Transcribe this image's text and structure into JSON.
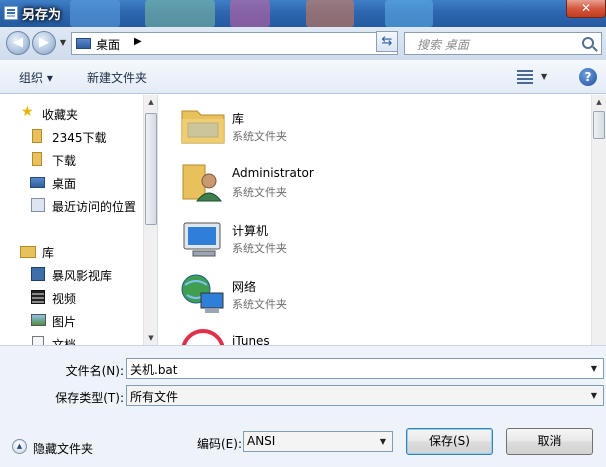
{
  "window": {
    "title": "另存为",
    "close_label": "✕"
  },
  "address": {
    "back_glyph": "◀",
    "forward_glyph": "▶",
    "location": "桌面",
    "separator": "▶",
    "search_placeholder": "搜索 桌面"
  },
  "toolbar": {
    "organize_label": "组织 ▾",
    "new_folder_label": "新建文件夹",
    "help_label": "?"
  },
  "sidebar": {
    "favorites_label": "收藏夹",
    "favorites": [
      {
        "label": "2345下载",
        "icon": "folder-icon"
      },
      {
        "label": "下载",
        "icon": "downloads-icon"
      },
      {
        "label": "桌面",
        "icon": "desktop-icon"
      },
      {
        "label": "最近访问的位置",
        "icon": "recent-places-icon"
      }
    ],
    "libraries_label": "库",
    "libraries": [
      {
        "label": "暴风影视库",
        "icon": "video-library-icon"
      },
      {
        "label": "视频",
        "icon": "video-icon"
      },
      {
        "label": "图片",
        "icon": "pictures-icon"
      },
      {
        "label": "文档",
        "icon": "documents-icon"
      }
    ]
  },
  "files": [
    {
      "name": "库",
      "type": "系统文件夹",
      "icon": "library-folder-icon"
    },
    {
      "name": "Administrator",
      "type": "系统文件夹",
      "icon": "user-folder-icon"
    },
    {
      "name": "计算机",
      "type": "系统文件夹",
      "icon": "computer-icon"
    },
    {
      "name": "网络",
      "type": "系统文件夹",
      "icon": "network-icon"
    },
    {
      "name": "iTunes",
      "type": "",
      "icon": "itunes-icon"
    }
  ],
  "form": {
    "filename_label": "文件名(N):",
    "filename_value": "关机.bat",
    "filetype_label": "保存类型(T):",
    "filetype_value": "所有文件",
    "encoding_label": "编码(E):",
    "encoding_value": "ANSI",
    "hide_folders_label": "隐藏文件夹",
    "save_label": "保存(S)",
    "cancel_label": "取消"
  }
}
